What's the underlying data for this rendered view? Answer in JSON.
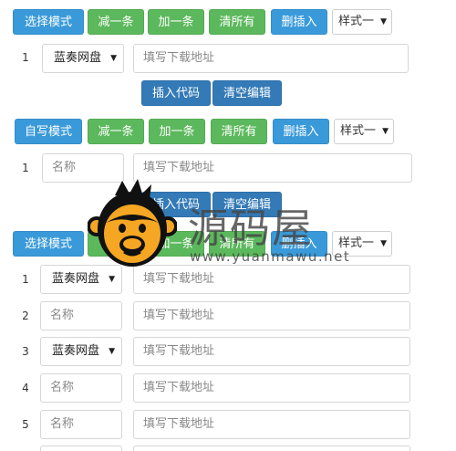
{
  "section1": {
    "mode_button": "选择模式",
    "minus_button": "减一条",
    "plus_button": "加一条",
    "clear_button": "清所有",
    "delete_insert_button": "删插入",
    "style_select": "样式一",
    "row": {
      "num": "1",
      "drive": "蓝奏网盘",
      "url_placeholder": "填写下载地址"
    },
    "insert_code_button": "插入代码",
    "clear_edit_button": "清空编辑"
  },
  "section2": {
    "mode_button": "自写模式",
    "minus_button": "减一条",
    "plus_button": "加一条",
    "clear_button": "清所有",
    "delete_insert_button": "删插入",
    "style_select": "样式一",
    "row": {
      "num": "1",
      "name_placeholder": "名称",
      "url_placeholder": "填写下载地址"
    },
    "insert_code_button": "插入代码",
    "clear_edit_button": "清空编辑"
  },
  "section3": {
    "mode_button": "选择模式",
    "plus_button": "加一条",
    "clear_button": "清所有",
    "delete_insert_button": "删插入",
    "style_select": "样式一",
    "rows": [
      {
        "num": "1",
        "first": "蓝奏网盘",
        "url_placeholder": "填写下载地址"
      },
      {
        "num": "2",
        "first": "名称",
        "url_placeholder": "填写下载地址"
      },
      {
        "num": "3",
        "first": "蓝奏网盘",
        "url_placeholder": "填写下载地址"
      },
      {
        "num": "4",
        "first": "名称",
        "url_placeholder": "填写下载地址"
      },
      {
        "num": "5",
        "first": "名称",
        "url_placeholder": "填写下载地址"
      }
    ]
  },
  "watermark": {
    "text": "源码屋",
    "url": "www.yuanmawu.net",
    "icon": "monkey-logo-icon"
  },
  "colors": {
    "blue": "#3a9ad9",
    "green": "#5cb85c",
    "dark_blue": "#337ab7",
    "logo_orange": "#f5a623"
  }
}
